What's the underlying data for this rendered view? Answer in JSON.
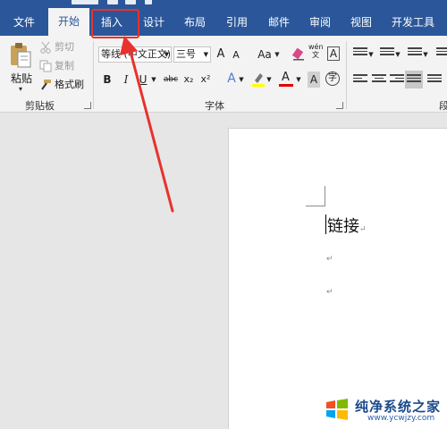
{
  "tabs": [
    {
      "label": "文件"
    },
    {
      "label": "开始",
      "active": true
    },
    {
      "label": "插入",
      "highlighted": true
    },
    {
      "label": "设计"
    },
    {
      "label": "布局"
    },
    {
      "label": "引用"
    },
    {
      "label": "邮件"
    },
    {
      "label": "审阅"
    },
    {
      "label": "视图"
    },
    {
      "label": "开发工具"
    }
  ],
  "clipboard": {
    "paste_label": "粘贴",
    "cut_label": "剪切",
    "copy_label": "复制",
    "format_painter_label": "格式刷",
    "group_label": "剪贴板"
  },
  "font": {
    "font_name": "等线 (中文正文)",
    "font_size": "三号",
    "grow_label": "A",
    "shrink_label": "A",
    "case_label": "Aa",
    "phonetic_label": "wén\n文",
    "border_label": "A",
    "bold": "B",
    "italic": "I",
    "underline": "U",
    "strike": "abc",
    "subscript": "x₂",
    "superscript": "x²",
    "effects_label": "A",
    "highlight_color": "#ffff00",
    "font_color": "#e00000",
    "font_color_label": "A",
    "shading_label": "A",
    "enclose_label": "字",
    "group_label": "字体"
  },
  "paragraph": {
    "group_label": "段"
  },
  "document": {
    "text": "链接",
    "para_mark": "↵"
  },
  "annotation": {
    "color": "#e8322e"
  },
  "watermark": {
    "name": "纯净系统之家",
    "url": "www.ycwjzy.com"
  },
  "colors": {
    "ribbon_blue": "#2b579a",
    "ribbon_bg": "#f3f3f3",
    "canvas_gray": "#e6e6e6"
  }
}
